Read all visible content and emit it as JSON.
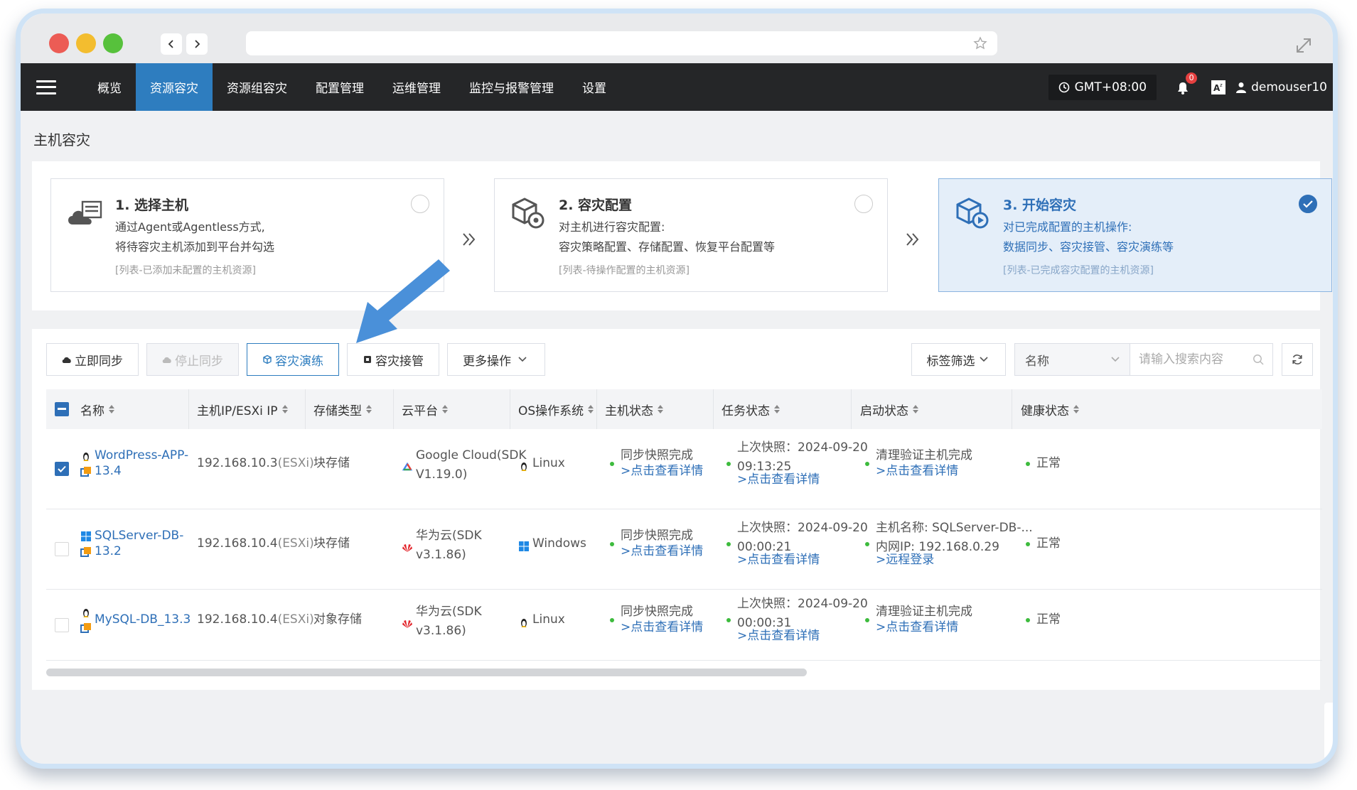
{
  "nav": {
    "items": [
      "概览",
      "资源容灾",
      "资源组容灾",
      "配置管理",
      "运维管理",
      "监控与报警管理",
      "设置"
    ],
    "active_index": 1,
    "timezone": "GMT+08:00",
    "notification_count": "0",
    "username": "demouser10"
  },
  "page": {
    "title": "主机容灾"
  },
  "steps": [
    {
      "title": "1. 选择主机",
      "desc1": "通过Agent或Agentless方式,",
      "desc2": "将待容灾主机添加到平台并勾选",
      "hint": "[列表-已添加未配置的主机资源]",
      "checked": false
    },
    {
      "title": "2. 容灾配置",
      "desc1": "对主机进行容灾配置:",
      "desc2": "容灾策略配置、存储配置、恢复平台配置等",
      "hint": "[列表-待操作配置的主机资源]",
      "checked": false
    },
    {
      "title": "3. 开始容灾",
      "desc1": "对已完成配置的主机操作:",
      "desc2": "数据同步、容灾接管、容灾演练等",
      "hint": "[列表-已完成容灾配置的主机资源]",
      "checked": true
    }
  ],
  "toolbar": {
    "sync_now": "立即同步",
    "stop_sync": "停止同步",
    "dr_drill": "容灾演练",
    "dr_takeover": "容灾接管",
    "more_ops": "更多操作",
    "tag_filter": "标签筛选",
    "search_field": "名称",
    "search_placeholder": "请输入搜索内容"
  },
  "table": {
    "columns": [
      "名称",
      "主机IP/ESXi IP",
      "存储类型",
      "云平台",
      "OS操作系统",
      "主机状态",
      "任务状态",
      "启动状态",
      "健康状态"
    ],
    "rows": [
      {
        "checked": true,
        "name1": "WordPress-APP-",
        "name2": "13.4",
        "os_icon": "linux-icon",
        "ip": "192.168.10.3",
        "ip_suffix": "(ESXi)",
        "storage": "块存储",
        "cloud1": "Google Cloud(SDK",
        "cloud2": "V1.19.0)",
        "cloud_icon": "google-cloud-icon",
        "os": "Linux",
        "host_status": "同步快照完成",
        "host_link": ">点击查看详情",
        "task1": "上次快照：2024-09-20",
        "task2": "09:13:25",
        "task_link": ">点击查看详情",
        "boot1": "清理验证主机完成",
        "boot2": "",
        "boot_link": ">点击查看详情",
        "health": "正常"
      },
      {
        "checked": false,
        "name1": "SQLServer-DB-",
        "name2": "13.2",
        "os_icon": "windows-icon",
        "ip": "192.168.10.4",
        "ip_suffix": "(ESXi)",
        "storage": "块存储",
        "cloud1": "华为云(SDK",
        "cloud2": "v3.1.86)",
        "cloud_icon": "huawei-cloud-icon",
        "os": "Windows",
        "host_status": "同步快照完成",
        "host_link": ">点击查看详情",
        "task1": "上次快照：2024-09-20",
        "task2": "00:00:21",
        "task_link": ">点击查看详情",
        "boot1": "主机名称: SQLServer-DB-...",
        "boot2": "内网IP: 192.168.0.29",
        "boot_link": ">远程登录",
        "health": "正常"
      },
      {
        "checked": false,
        "name1": "MySQL-DB_13.3",
        "name2": "",
        "os_icon": "linux-icon",
        "ip": "192.168.10.4",
        "ip_suffix": "(ESXi)",
        "storage": "对象存储",
        "cloud1": "华为云(SDK",
        "cloud2": "v3.1.86)",
        "cloud_icon": "huawei-cloud-icon",
        "os": "Linux",
        "host_status": "同步快照完成",
        "host_link": ">点击查看详情",
        "task1": "上次快照：2024-09-20",
        "task2": "00:00:31",
        "task_link": ">点击查看详情",
        "boot1": "清理验证主机完成",
        "boot2": "",
        "boot_link": ">点击查看详情",
        "health": "正常"
      }
    ]
  },
  "colors": {
    "nav_bg": "#252628",
    "accent": "#2e7dbf",
    "link": "#2e6fb7",
    "ok_dot": "#3dbb3d",
    "annotation_arrow": "#4a90d9"
  }
}
